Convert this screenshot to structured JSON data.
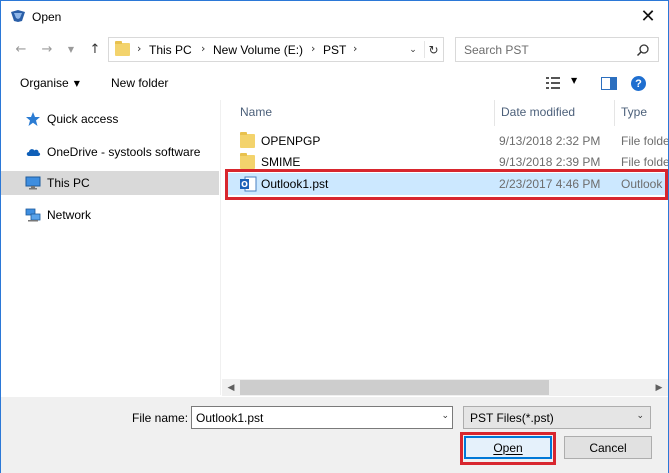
{
  "window": {
    "title": "Open",
    "close_glyph": "✕"
  },
  "nav": {
    "back_icon": "arrow-left-icon",
    "forward_icon": "arrow-right-icon",
    "recent_icon": "chevron-down-icon",
    "up_icon": "arrow-up-icon",
    "breadcrumbs": [
      "This PC",
      "New Volume (E:)",
      "PST"
    ],
    "separator": "›"
  },
  "search": {
    "placeholder": "Search PST"
  },
  "toolbar": {
    "organise_label": "Organise",
    "new_folder_label": "New folder"
  },
  "sidebar": {
    "items": [
      {
        "label": "Quick access",
        "icon": "star-icon"
      },
      {
        "label": "OneDrive - systools software",
        "icon": "cloud-icon"
      },
      {
        "label": "This PC",
        "icon": "computer-icon",
        "selected": true
      },
      {
        "label": "Network",
        "icon": "network-icon"
      }
    ]
  },
  "filelist": {
    "columns": [
      "Name",
      "Date modified",
      "Type"
    ],
    "rows": [
      {
        "name": "OPENPGP",
        "date": "9/13/2018 2:32 PM",
        "type": "File folder",
        "icon": "folder-icon"
      },
      {
        "name": "SMIME",
        "date": "9/13/2018 2:39 PM",
        "type": "File folder",
        "icon": "folder-icon"
      },
      {
        "name": "Outlook1.pst",
        "date": "2/23/2017 4:46 PM",
        "type": "Outlook Data File",
        "icon": "outlook-pst-icon",
        "selected": true
      }
    ]
  },
  "footer": {
    "file_name_label": "File name:",
    "file_name_value": "Outlook1.pst",
    "file_type_value": "PST Files(*.pst)",
    "open_label": "Open",
    "cancel_label": "Cancel"
  },
  "colors": {
    "selection": "#cce8ff",
    "highlight": "#d8262e",
    "accent": "#0078d7"
  }
}
